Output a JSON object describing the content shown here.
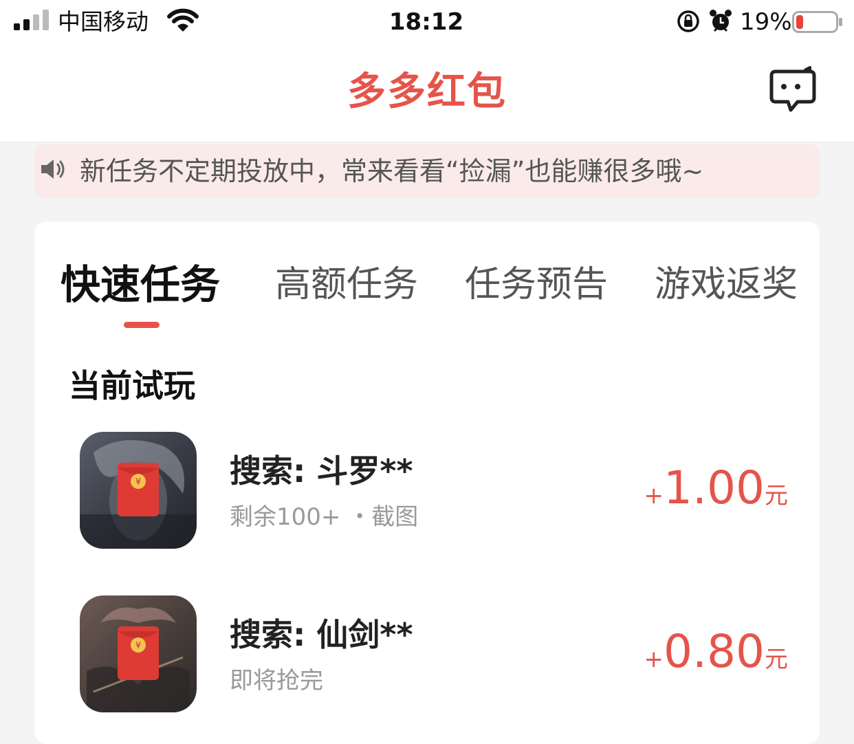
{
  "status_bar": {
    "carrier": "中国移动",
    "time": "18:12",
    "battery_percent": "19%",
    "battery_level": 0.19,
    "battery_color": "#e8433a"
  },
  "nav": {
    "title": "多多红包",
    "service_icon": "customer-service-icon"
  },
  "notice": {
    "icon": "speaker-icon",
    "text": "新任务不定期投放中，常来看看“捡漏”也能赚很多哦~"
  },
  "tabs": [
    {
      "label": "快速任务",
      "active": true
    },
    {
      "label": "高额任务",
      "active": false
    },
    {
      "label": "任务预告",
      "active": false
    },
    {
      "label": "游戏返奖",
      "active": false
    }
  ],
  "section_title": "当前试玩",
  "tasks": [
    {
      "name": "搜索: 斗罗**",
      "meta": "剩余100+ ・截图",
      "plus": "+",
      "amount": "1.00",
      "unit": "元"
    },
    {
      "name": "搜索: 仙剑**",
      "meta": "即将抢完",
      "plus": "+",
      "amount": "0.80",
      "unit": "元"
    }
  ],
  "colors": {
    "accent": "#e5544a",
    "notice_bg": "#fbeaea"
  }
}
